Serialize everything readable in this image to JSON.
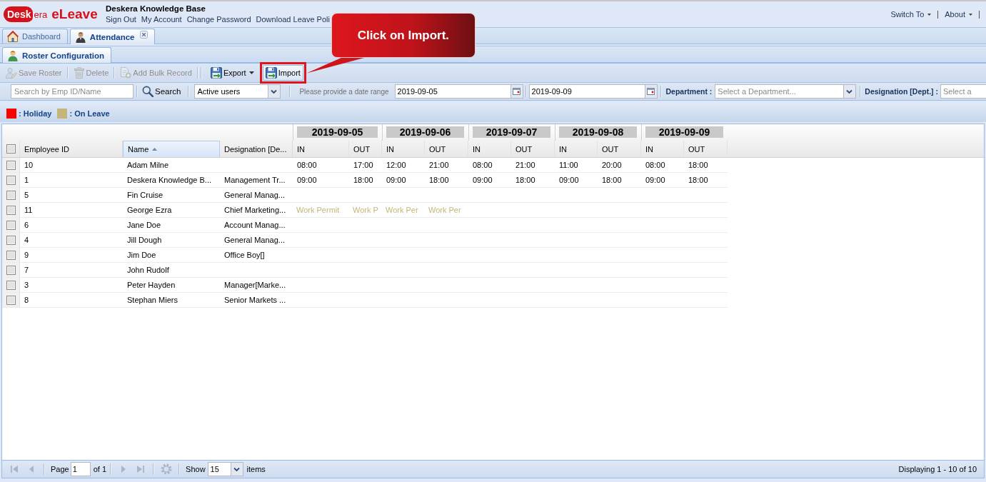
{
  "header": {
    "logo": {
      "mark": "Desk",
      "rest": "era",
      "product": "eLeave"
    },
    "title": "Deskera Knowledge Base",
    "links": [
      "Sign Out",
      "My Account",
      "Change Password",
      "Download Leave Poli"
    ],
    "menus": [
      "Switch To",
      "About"
    ]
  },
  "main_tabs": [
    {
      "kind": "dashboard",
      "label": "Dashboard",
      "selected": false,
      "closable": false
    },
    {
      "kind": "attendance",
      "label": "Attendance",
      "selected": true,
      "closable": true
    }
  ],
  "sub_tabs": [
    {
      "kind": "roster",
      "label": "Roster Configuration",
      "selected": true,
      "closable": false
    }
  ],
  "toolbar": [
    {
      "kind": "save",
      "label": "Save Roster",
      "disabled": true,
      "menu": false,
      "highlighted": false
    },
    {
      "kind": "delete",
      "label": "Delete",
      "disabled": true,
      "menu": false,
      "highlighted": false
    },
    {
      "kind": "bulk",
      "label": "Add Bulk Record",
      "disabled": true,
      "menu": false,
      "highlighted": false
    },
    {
      "kind": "export",
      "label": "Export",
      "disabled": false,
      "menu": true,
      "highlighted": false
    },
    {
      "kind": "import",
      "label": "Import",
      "disabled": false,
      "menu": false,
      "highlighted": true
    }
  ],
  "callout": {
    "text": "Click on Import."
  },
  "filters": {
    "search": {
      "placeholder": "Search by Emp ID/Name"
    },
    "search_button": "Search",
    "user_status": {
      "value": "Active users"
    },
    "date_hint": "Please provide a date range",
    "date_from": {
      "value": "2019-09-05"
    },
    "date_to": {
      "value": "2019-09-09"
    },
    "department": {
      "label": "Department :",
      "placeholder": "Select a Department..."
    },
    "designation": {
      "label": "Designation [Dept.] :",
      "placeholder": "Select a"
    }
  },
  "legend": [
    {
      "label": ": Holiday",
      "color": "#ff0000"
    },
    {
      "label": ": On Leave",
      "color": "#c2b67a"
    }
  ],
  "grid": {
    "all_selected": false,
    "columns": [
      {
        "label": "Employee ID",
        "sorted": false
      },
      {
        "label": "Name",
        "sorted": true
      },
      {
        "label": "Designation [De...",
        "sorted": false
      }
    ],
    "days": [
      {
        "date": "2019-09-05",
        "in": "IN",
        "out": "OUT"
      },
      {
        "date": "2019-09-06",
        "in": "IN",
        "out": "OUT"
      },
      {
        "date": "2019-09-07",
        "in": "IN",
        "out": "OUT"
      },
      {
        "date": "2019-09-08",
        "in": "IN",
        "out": "OUT"
      },
      {
        "date": "2019-09-09",
        "in": "IN",
        "out": "OUT"
      }
    ],
    "rows": [
      {
        "selected": false,
        "id": "10",
        "name": "Adam Milne",
        "cells": [
          {
            "kind": "time",
            "text": "08:00"
          },
          {
            "kind": "time",
            "text": "17:00"
          },
          {
            "kind": "time",
            "text": "12:00"
          },
          {
            "kind": "time",
            "text": "21:00"
          },
          {
            "kind": "time",
            "text": "08:00"
          },
          {
            "kind": "time",
            "text": "21:00"
          },
          {
            "kind": "time",
            "text": "11:00"
          },
          {
            "kind": "time",
            "text": "20:00"
          },
          {
            "kind": "time",
            "text": "08:00"
          },
          {
            "kind": "time",
            "text": "18:00"
          }
        ]
      },
      {
        "selected": false,
        "id": "1",
        "name": "Deskera Knowledge B...",
        "designation": "Management Tr...",
        "cells": [
          {
            "kind": "time",
            "text": "09:00"
          },
          {
            "kind": "time",
            "text": "18:00"
          },
          {
            "kind": "time",
            "text": "09:00"
          },
          {
            "kind": "time",
            "text": "18:00"
          },
          {
            "kind": "time",
            "text": "09:00"
          },
          {
            "kind": "time",
            "text": "18:00"
          },
          {
            "kind": "time",
            "text": "09:00"
          },
          {
            "kind": "time",
            "text": "18:00"
          },
          {
            "kind": "time",
            "text": "09:00"
          },
          {
            "kind": "time",
            "text": "18:00"
          }
        ]
      },
      {
        "selected": false,
        "id": "5",
        "name": "Fin Cruise",
        "designation": "General Manag..."
      },
      {
        "selected": false,
        "id": "11",
        "name": "George Ezra",
        "designation": "Chief Marketing...",
        "cells": [
          {
            "kind": "leave",
            "text": "Work Permit"
          },
          {
            "kind": "leave",
            "text": "Work P"
          },
          {
            "kind": "leave",
            "text": "Work Per"
          },
          {
            "kind": "leave",
            "text": "Work Per"
          }
        ]
      },
      {
        "selected": false,
        "id": "6",
        "name": "Jane Doe",
        "designation": "Account Manag..."
      },
      {
        "selected": false,
        "id": "4",
        "name": "Jill Dough",
        "designation": "General Manag..."
      },
      {
        "selected": false,
        "id": "9",
        "name": "Jim Doe",
        "designation": "Office Boy[]"
      },
      {
        "selected": false,
        "id": "7",
        "name": "John Rudolf"
      },
      {
        "selected": false,
        "id": "3",
        "name": "Peter Hayden",
        "designation": "Manager[Marke..."
      },
      {
        "selected": false,
        "id": "8",
        "name": "Stephan Miers",
        "designation": "Senior Markets ..."
      }
    ]
  },
  "paging": {
    "nav": [
      {
        "kind": "first",
        "disabled": true
      },
      {
        "kind": "prev",
        "disabled": true
      },
      {
        "kind": "next",
        "disabled": true
      },
      {
        "kind": "last",
        "disabled": true
      },
      {
        "kind": "refresh",
        "disabled": false
      }
    ],
    "page_label": "Page",
    "page": "1",
    "page_count": "of 1",
    "show_label": "Show",
    "page_size": "15",
    "items_label": "items",
    "status": "Displaying 1 - 10 of 10"
  }
}
